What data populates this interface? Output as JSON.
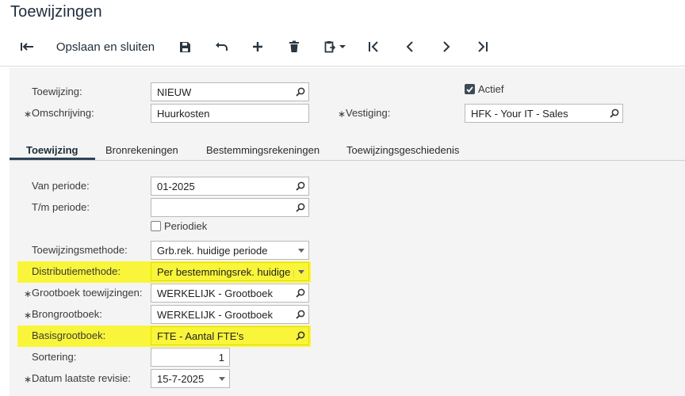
{
  "page": {
    "title": "Toewijzingen"
  },
  "toolbar": {
    "save_close_label": "Opslaan en sluiten"
  },
  "header": {
    "toewijzing_label": "Toewijzing:",
    "toewijzing_value": "NIEUW",
    "omschrijving_label": "Omschrijving:",
    "omschrijving_value": "Huurkosten",
    "actief_label": "Actief",
    "actief_checked": true,
    "vestiging_label": "Vestiging:",
    "vestiging_value": "HFK - Your IT - Sales",
    "required_marker": "∗"
  },
  "tabs": [
    {
      "label": "Toewijzing",
      "active": true
    },
    {
      "label": "Bronrekeningen",
      "active": false
    },
    {
      "label": "Bestemmingsrekeningen",
      "active": false
    },
    {
      "label": "Toewijzingsgeschiedenis",
      "active": false
    }
  ],
  "details": {
    "van_periode_label": "Van periode:",
    "van_periode_value": "01-2025",
    "tm_periode_label": "T/m periode:",
    "tm_periode_value": "",
    "periodiek_label": "Periodiek",
    "periodiek_checked": false,
    "methode_label": "Toewijzingsmethode:",
    "methode_value": "Grb.rek. huidige periode",
    "distributie_label": "Distributiemethode:",
    "distributie_value": "Per bestemmingsrek. huidige pe",
    "grootboek_toew_label": "Grootboek toewijzingen:",
    "grootboek_toew_value": "WERKELIJK - Grootboek",
    "brongrootboek_label": "Brongrootboek:",
    "brongrootboek_value": "WERKELIJK - Grootboek",
    "basisgrootboek_label": "Basisgrootboek:",
    "basisgrootboek_value": "FTE - Aantal FTE's",
    "sortering_label": "Sortering:",
    "sortering_value": "1",
    "datum_label": "Datum laatste revisie:",
    "datum_value": "15-7-2025"
  },
  "colors": {
    "highlight": "#f9f53a",
    "accent": "#2f4358"
  }
}
